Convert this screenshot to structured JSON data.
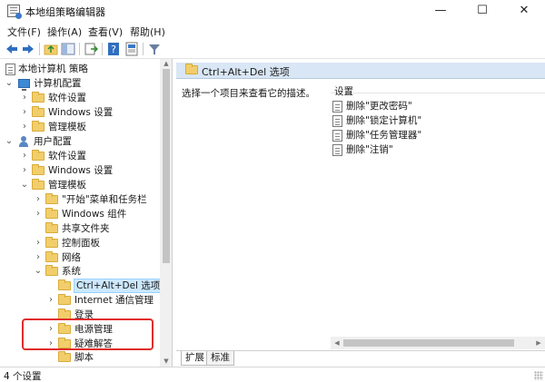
{
  "window": {
    "title": "本地组策略编辑器",
    "controls": {
      "minimize": "—",
      "maximize": "☐",
      "close": "✕"
    }
  },
  "menu": [
    "文件(F)",
    "操作(A)",
    "查看(V)",
    "帮助(H)"
  ],
  "toolbar": {
    "icons": [
      "back-arrow-icon",
      "forward-arrow-icon",
      "up-folder-icon",
      "show-hide-tree-icon",
      "export-list-icon",
      "help-icon",
      "properties-icon",
      "filter-icon"
    ]
  },
  "tree": {
    "root": "本地计算机 策略",
    "computer_config": "计算机配置",
    "cc_software": "软件设置",
    "cc_windows": "Windows 设置",
    "cc_admin": "管理模板",
    "user_config": "用户配置",
    "uc_software": "软件设置",
    "uc_windows": "Windows 设置",
    "uc_admin": "管理模板",
    "start_menu": "\"开始\"菜单和任务栏",
    "win_components": "Windows 组件",
    "shared_folders": "共享文件夹",
    "control_panel": "控制面板",
    "network": "网络",
    "system": "系统",
    "cad_options": "Ctrl+Alt+Del 选项",
    "internet_comm": "Internet 通信管理",
    "logon": "登录",
    "power_mgmt": "电源管理",
    "troubleshoot": "疑难解答",
    "scripts": "脚本"
  },
  "detail": {
    "header": "Ctrl+Alt+Del 选项",
    "description": "选择一个项目来查看它的描述。",
    "column_header": "设置",
    "items": [
      "删除\"更改密码\"",
      "删除\"锁定计算机\"",
      "删除\"任务管理器\"",
      "删除\"注销\""
    ]
  },
  "tabs": [
    "扩展",
    "标准"
  ],
  "status": "4 个设置",
  "colors": {
    "selection": "#cce8ff",
    "highlight_border": "#e02c2c",
    "header_bg": "#d9e6f5",
    "folder": "#f1ce6b"
  }
}
